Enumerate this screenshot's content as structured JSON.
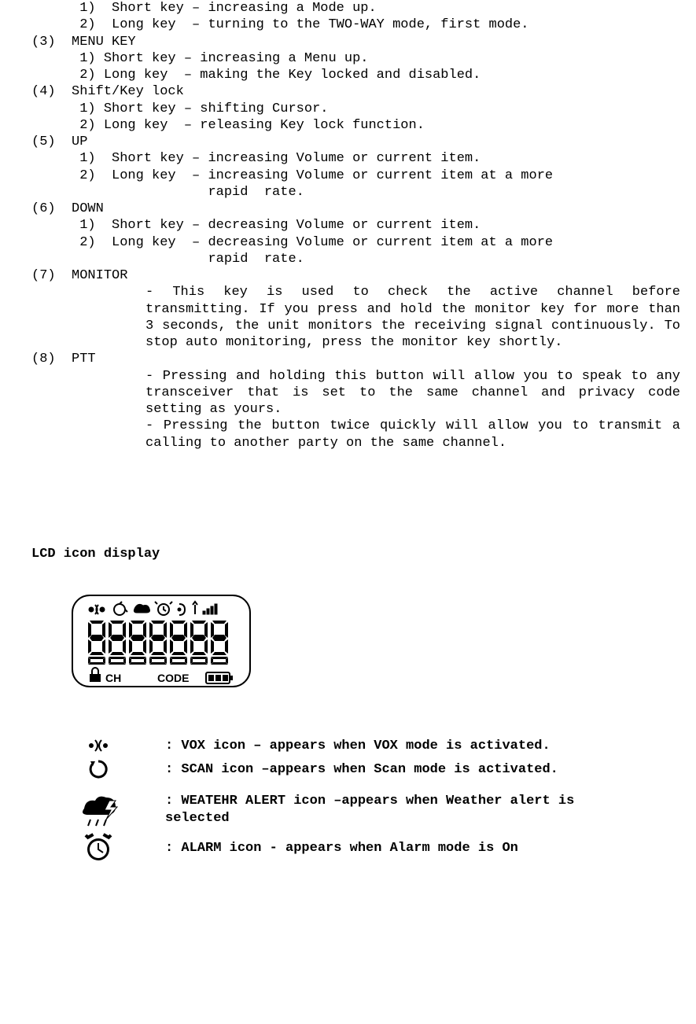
{
  "list2": {
    "item1": "1)  Short key – increasing a Mode up.",
    "item2": "2)  Long key  – turning to the TWO-WAY mode, first mode."
  },
  "sec3": {
    "head": "(3)  MENU KEY",
    "item1": "1) Short key – increasing a Menu up.",
    "item2": "2) Long key  – making the Key locked and disabled."
  },
  "sec4": {
    "head": "(4)  Shift/Key lock",
    "item1": "1) Short key – shifting Cursor.",
    "item2": "2) Long key  – releasing Key lock function."
  },
  "sec5": {
    "head": "(5)  UP",
    "item1": "1)  Short key – increasing Volume or current item.",
    "item2": "2)  Long key  – increasing Volume or current item at a more",
    "item2b": "                rapid  rate."
  },
  "sec6": {
    "head": "(6)  DOWN",
    "item1": "1)  Short key – decreasing Volume or current item.",
    "item2": "2)  Long key  – decreasing Volume or current item at a more",
    "item2b": "                rapid  rate."
  },
  "sec7": {
    "head": "(7)  MONITOR",
    "para": "-  This key is used to check the active channel before transmitting. If you press and hold the monitor key for more than 3 seconds, the unit monitors the receiving signal continuously. To stop auto monitoring, press the monitor key shortly."
  },
  "sec8": {
    "head": "(8)  PTT",
    "para1": "-  Pressing and holding this button will allow you to speak to any transceiver that is set to the same channel and privacy code setting as yours.",
    "para2": "-  Pressing the button twice quickly will allow you to transmit a calling to another party on the same channel."
  },
  "lcdTitle": "LCD icon display",
  "lcdLabels": {
    "ch": "CH",
    "code": "CODE"
  },
  "iconDesc": {
    "vox": ": VOX icon – appears when VOX mode is activated.",
    "scan": ": SCAN icon –appears when Scan mode is activated.",
    "weather1": ": WEATEHR ALERT icon –appears when Weather alert is",
    "weather2": " selected",
    "alarm": ": ALARM icon  - appears when Alarm mode is On"
  }
}
